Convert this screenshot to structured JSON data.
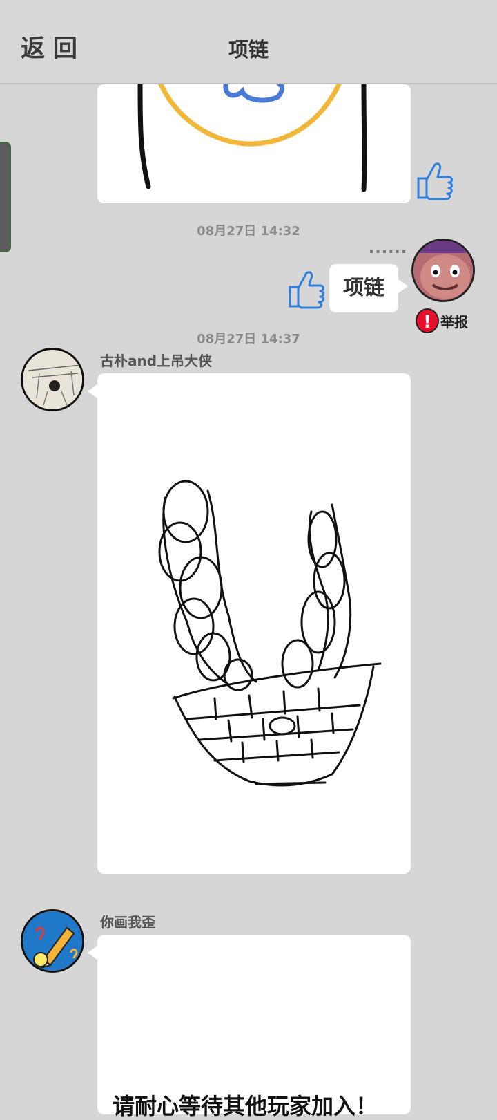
{
  "header": {
    "back_label": "返回",
    "title": "项链"
  },
  "messages": {
    "ts1": "08月27日  14:32",
    "my_guess": "项链",
    "more_dots": "......",
    "report_label": "举报",
    "ts2": "08月27日  14:37",
    "user1_name": "古朴and上吊大侠",
    "user2_name": "你画我歪",
    "wait_text": "请耐心等待其他玩家加入！"
  },
  "icons": {
    "like": "thumbs-up-icon",
    "report": "exclamation-icon"
  },
  "colors": {
    "background": "#d6d6d6",
    "like_blue": "#2f7fe0",
    "report_red": "#e8102a"
  }
}
